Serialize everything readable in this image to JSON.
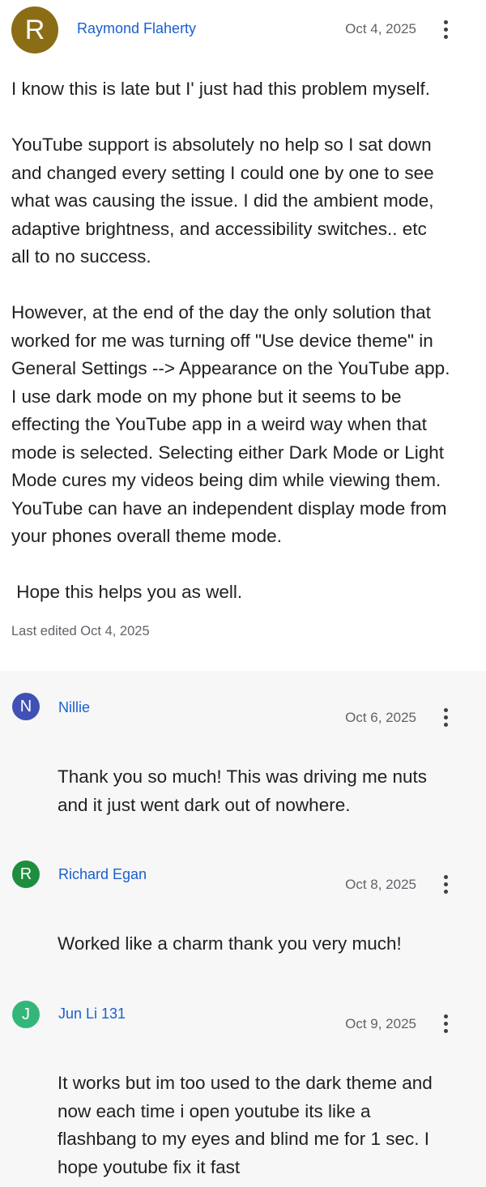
{
  "post": {
    "avatar": {
      "letter": "R",
      "color": "#8b6d16"
    },
    "author": "Raymond Flaherty",
    "date": "Oct 4, 2025",
    "paragraphs": [
      [
        "I know this is late but I' just had this problem myself."
      ],
      [
        "YouTube support is absolutely no help so I sat down",
        "and changed every setting I could one by one to see",
        "what was causing the issue. I did the ambient mode,",
        "adaptive brightness, and accessibility switches.. etc",
        "all to no success."
      ],
      [
        "However, at the end of the day the only solution that",
        "worked for me was turning off \"Use device theme\" in",
        "General Settings --> Appearance on the YouTube app.",
        "I use dark mode on my phone but it seems to be",
        "effecting the YouTube app in a weird way when that",
        "mode is selected. Selecting either Dark Mode or Light",
        "Mode cures my videos being dim while viewing them.",
        "YouTube can have an independent display mode from",
        "your phones overall theme mode."
      ],
      [
        " Hope this helps you as well."
      ]
    ],
    "edited": "Last edited Oct 4, 2025"
  },
  "replies": [
    {
      "avatar": {
        "letter": "N",
        "color": "#3f51b5"
      },
      "author": "Nillie",
      "date": "Oct 6, 2025",
      "lines": [
        "Thank you so much! This was driving me nuts",
        "and it just went dark out of nowhere."
      ]
    },
    {
      "avatar": {
        "letter": "R",
        "color": "#1e8e3e"
      },
      "author": "Richard Egan",
      "date": "Oct 8, 2025",
      "lines": [
        "Worked like a charm thank you very much!"
      ]
    },
    {
      "avatar": {
        "letter": "J",
        "color": "#33b679"
      },
      "author": "Jun Li 131",
      "date": "Oct 9, 2025",
      "lines": [
        "It works but im too used to the dark theme and",
        "now each time i open youtube its like a",
        "flashbang to my eyes and blind me for 1 sec. I",
        "hope youtube fix it fast"
      ]
    }
  ]
}
